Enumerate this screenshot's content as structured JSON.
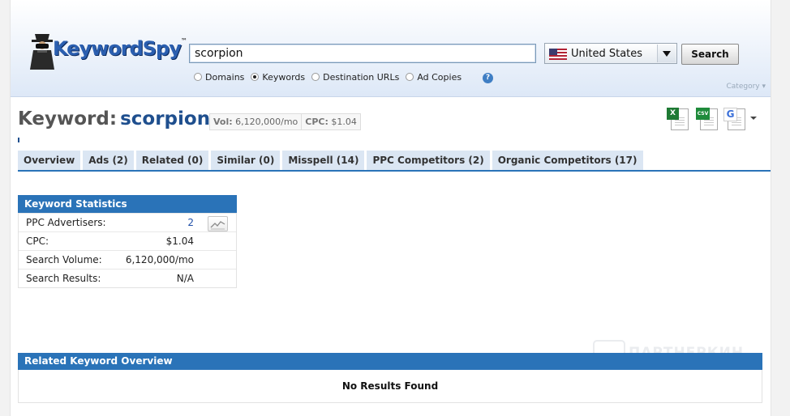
{
  "brand": {
    "logo_text": "KeywordSpy",
    "logo_mark": "™"
  },
  "search": {
    "query": "scorpion",
    "button_label": "Search"
  },
  "country": {
    "label": "United States",
    "flag_icon": "us-flag-icon"
  },
  "search_types": [
    {
      "label": "Domains",
      "selected": false
    },
    {
      "label": "Keywords",
      "selected": true
    },
    {
      "label": "Destination URLs",
      "selected": false
    },
    {
      "label": "Ad Copies",
      "selected": false
    }
  ],
  "help_glyph": "?",
  "category_label": "Category",
  "keyword": {
    "prefix": "Keyword:",
    "value": "scorpion",
    "vol_label": "Vol:",
    "vol_value": "6,120,000/mo",
    "cpc_label": "CPC:",
    "cpc_value": "$1.04"
  },
  "exports": {
    "excel_icon": "excel-export-icon",
    "csv_badge": "CSV",
    "google_badge": "G"
  },
  "tabs": [
    "Overview",
    "Ads (2)",
    "Related (0)",
    "Similar (0)",
    "Misspell (14)",
    "PPC Competitors (2)",
    "Organic Competitors (17)"
  ],
  "stats": {
    "title": "Keyword Statistics",
    "rows": [
      {
        "label": "PPC Advertisers:",
        "value": "2"
      },
      {
        "label": "CPC:",
        "value": "$1.04"
      },
      {
        "label": "Search Volume:",
        "value": "6,120,000/mo"
      },
      {
        "label": "Search Results:",
        "value": "N/A"
      }
    ]
  },
  "related": {
    "title": "Related Keyword Overview",
    "empty_text": "No Results Found"
  },
  "watermark_text": "ПАРТНЕРКИН",
  "colors": {
    "accent": "#2a73b8",
    "tab_bg": "#dbe6f3",
    "keyword_value": "#1f4f8e"
  }
}
